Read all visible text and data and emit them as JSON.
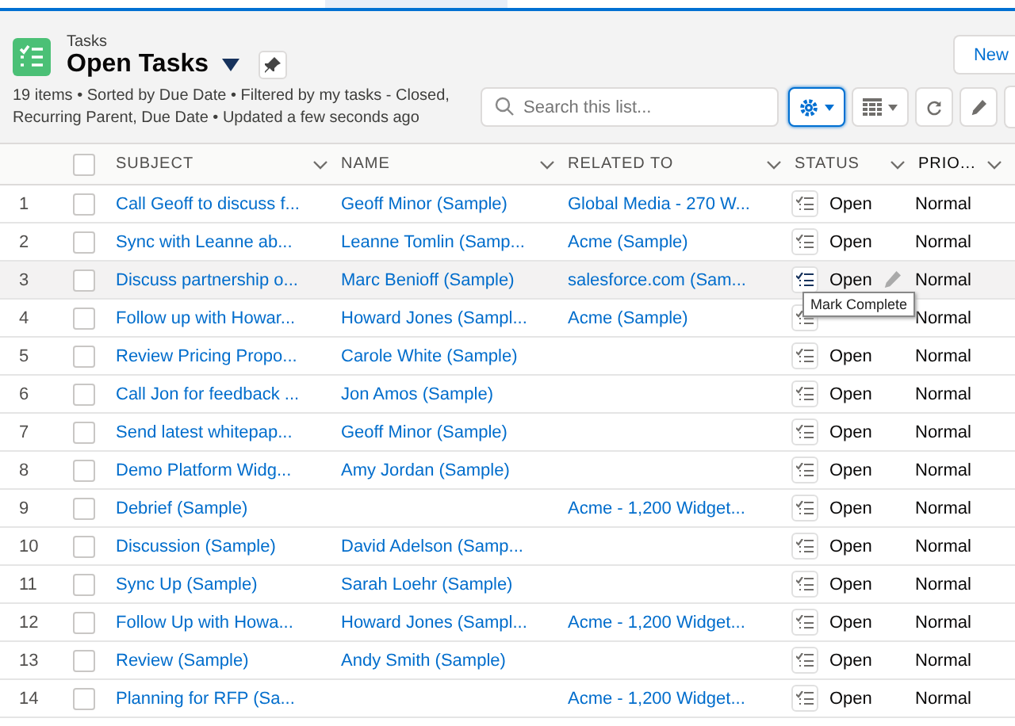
{
  "header": {
    "object_label": "Tasks",
    "title": "Open Tasks",
    "summary": "19 items • Sorted by Due Date • Filtered by my tasks - Closed, Recurring Parent, Due Date • Updated a few seconds ago",
    "new_button": "New"
  },
  "search": {
    "placeholder": "Search this list..."
  },
  "toolbar": [
    {
      "kind": "settings",
      "selected": true
    },
    {
      "kind": "display",
      "selected": false
    },
    {
      "kind": "refresh",
      "selected": false
    },
    {
      "kind": "edit",
      "selected": false
    }
  ],
  "table": {
    "select_all_checked": false,
    "columns": [
      "SUBJECT",
      "NAME",
      "RELATED TO",
      "STATUS",
      "PRIO..."
    ],
    "rows": [
      {
        "number": "1",
        "subject": "Call Geoff to discuss f...",
        "name": "Geoff Minor (Sample)",
        "related_to": "Global Media - 270 W...",
        "status": "Open",
        "priority": "Normal",
        "hovered": false
      },
      {
        "number": "2",
        "subject": "Sync with Leanne ab...",
        "name": "Leanne Tomlin (Samp...",
        "related_to": "Acme (Sample)",
        "status": "Open",
        "priority": "Normal",
        "hovered": false
      },
      {
        "number": "3",
        "subject": "Discuss partnership o...",
        "name": "Marc Benioff (Sample)",
        "related_to": "salesforce.com (Sam...",
        "status": "Open",
        "priority": "Normal",
        "hovered": true
      },
      {
        "number": "4",
        "subject": "Follow up with Howar...",
        "name": "Howard Jones (Sampl...",
        "related_to": "Acme (Sample)",
        "priority": "Normal",
        "hovered": false
      },
      {
        "number": "5",
        "subject": "Review Pricing Propo...",
        "name": "Carole White (Sample)",
        "status": "Open",
        "priority": "Normal",
        "hovered": false
      },
      {
        "number": "6",
        "subject": "Call Jon for feedback ...",
        "name": "Jon Amos (Sample)",
        "status": "Open",
        "priority": "Normal",
        "hovered": false
      },
      {
        "number": "7",
        "subject": "Send latest whitepap...",
        "name": "Geoff Minor (Sample)",
        "status": "Open",
        "priority": "Normal",
        "hovered": false
      },
      {
        "number": "8",
        "subject": "Demo Platform Widg...",
        "name": "Amy Jordan (Sample)",
        "status": "Open",
        "priority": "Normal",
        "hovered": false
      },
      {
        "number": "9",
        "subject": "Debrief (Sample)",
        "related_to": "Acme - 1,200 Widget...",
        "status": "Open",
        "priority": "Normal",
        "hovered": false
      },
      {
        "number": "10",
        "subject": "Discussion (Sample)",
        "name": "David Adelson (Samp...",
        "status": "Open",
        "priority": "Normal",
        "hovered": false
      },
      {
        "number": "11",
        "subject": "Sync Up (Sample)",
        "name": "Sarah Loehr (Sample)",
        "status": "Open",
        "priority": "Normal",
        "hovered": false
      },
      {
        "number": "12",
        "subject": "Follow Up with Howa...",
        "name": "Howard Jones (Sampl...",
        "related_to": "Acme - 1,200 Widget...",
        "status": "Open",
        "priority": "Normal",
        "hovered": false
      },
      {
        "number": "13",
        "subject": "Review (Sample)",
        "name": "Andy Smith (Sample)",
        "status": "Open",
        "priority": "Normal",
        "hovered": false
      },
      {
        "number": "14",
        "subject": "Planning for RFP (Sa...",
        "related_to": "Acme - 1,200 Widget...",
        "status": "Open",
        "priority": "Normal",
        "hovered": false
      }
    ]
  },
  "tooltip": {
    "text": "Mark Complete"
  }
}
